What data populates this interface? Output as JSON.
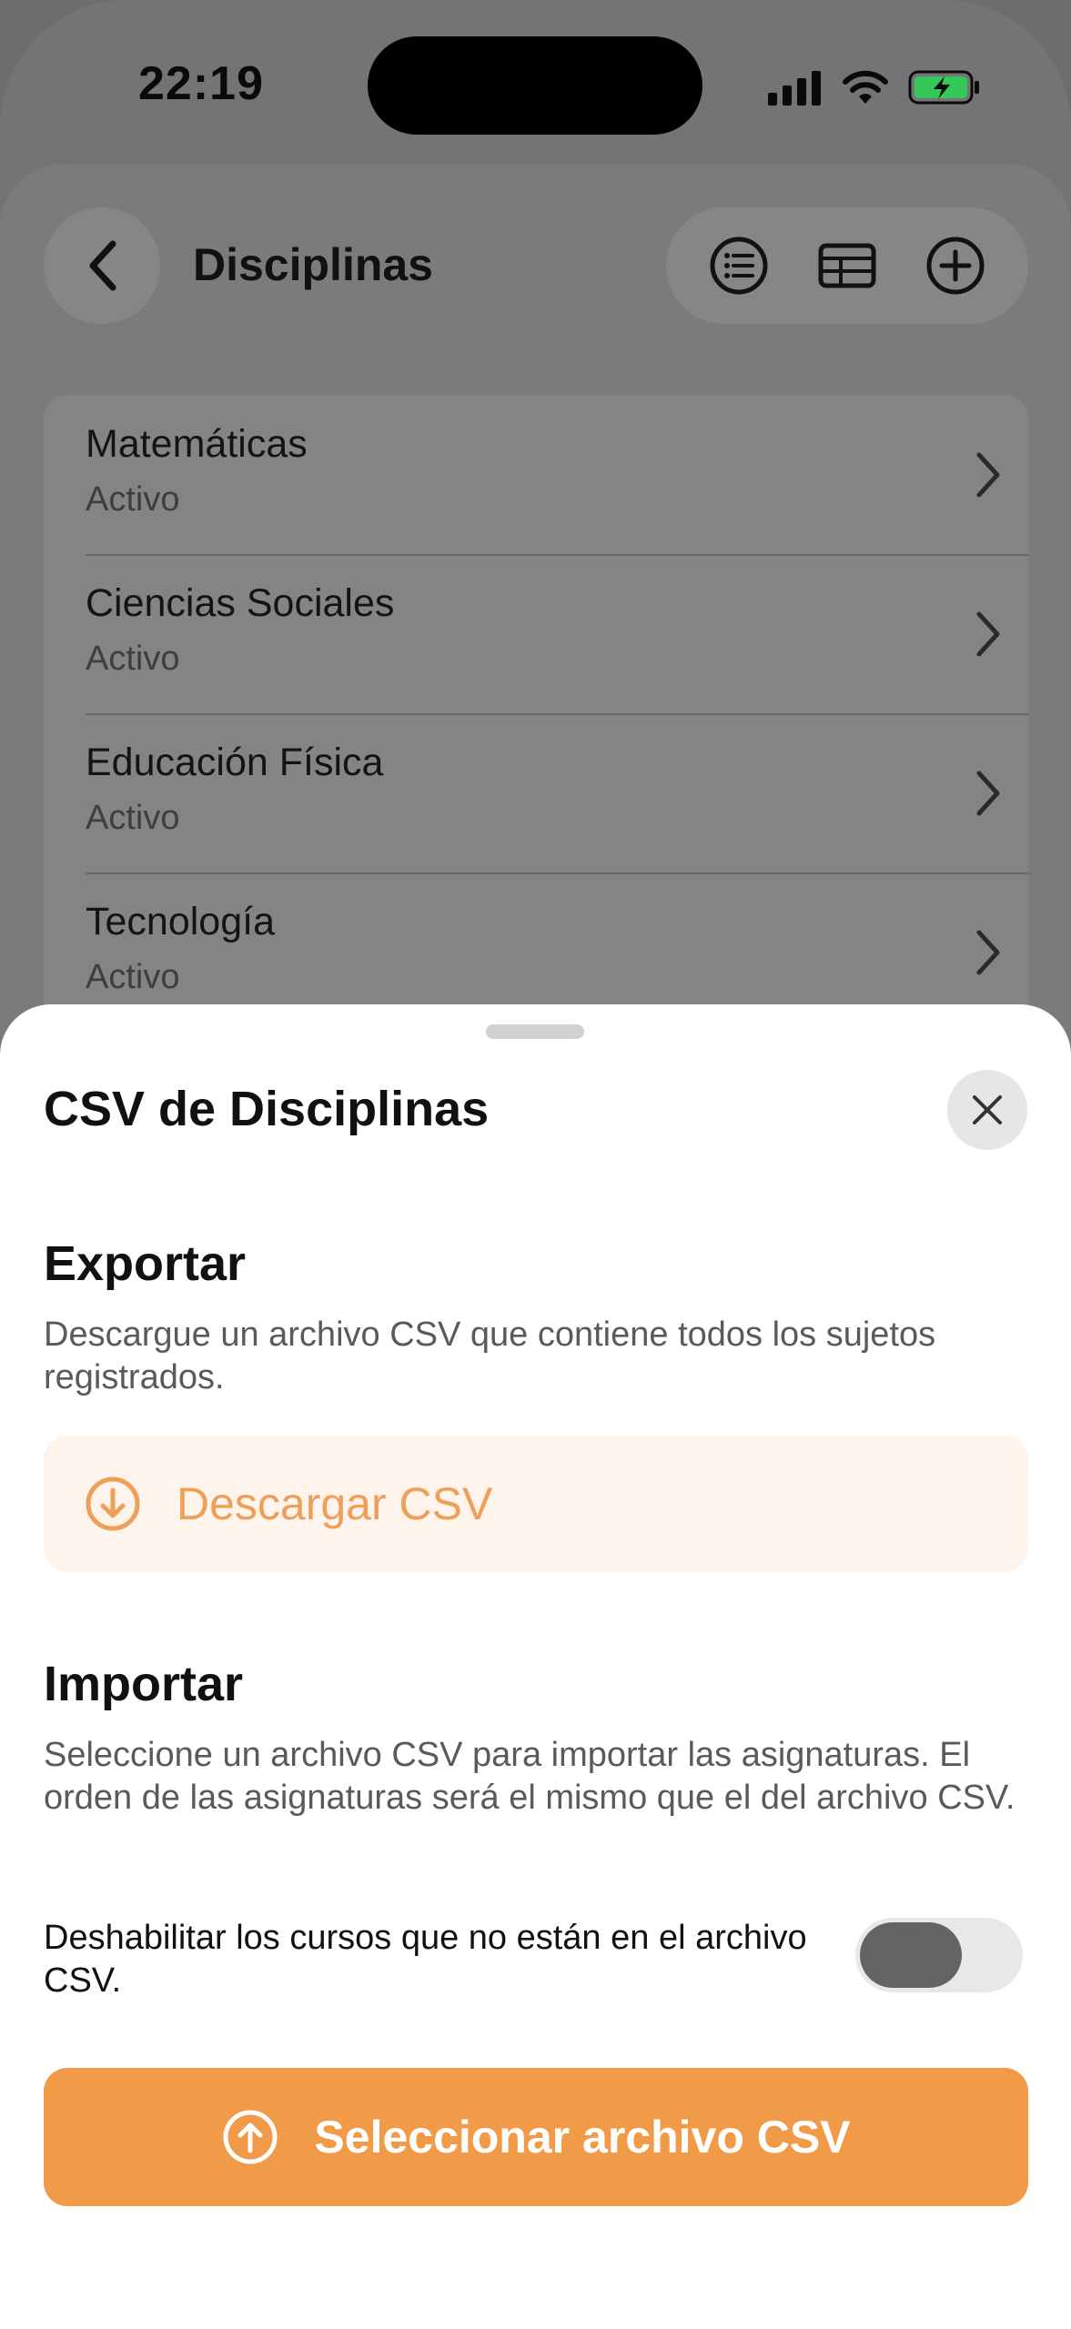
{
  "status_bar": {
    "time": "22:19",
    "battery_color": "#34c759"
  },
  "nav": {
    "title": "Disciplinas",
    "back_icon": "chevron-left-icon",
    "actions": [
      "list-icon",
      "table-icon",
      "plus-circle-icon"
    ]
  },
  "list": {
    "items": [
      {
        "title": "Matemáticas",
        "status": "Activo"
      },
      {
        "title": "Ciencias Sociales",
        "status": "Activo"
      },
      {
        "title": "Educación Física",
        "status": "Activo"
      },
      {
        "title": "Tecnología",
        "status": "Activo"
      }
    ]
  },
  "sheet": {
    "title": "CSV de Disciplinas",
    "export": {
      "heading": "Exportar",
      "description": "Descargue un archivo CSV que contiene todos los sujetos registrados.",
      "button_label": "Descargar CSV"
    },
    "import": {
      "heading": "Importar",
      "description": "Seleccione un archivo CSV para importar las asignaturas. El orden de las asignaturas será el mismo que el del archivo CSV.",
      "toggle_label": "Deshabilitar los cursos que no están en el archivo CSV.",
      "toggle_on": false,
      "button_label": "Seleccionar archivo CSV"
    }
  },
  "colors": {
    "accent": "#f19a47",
    "accent_soft": "#fef4ec",
    "accent_text": "#eea05a"
  }
}
